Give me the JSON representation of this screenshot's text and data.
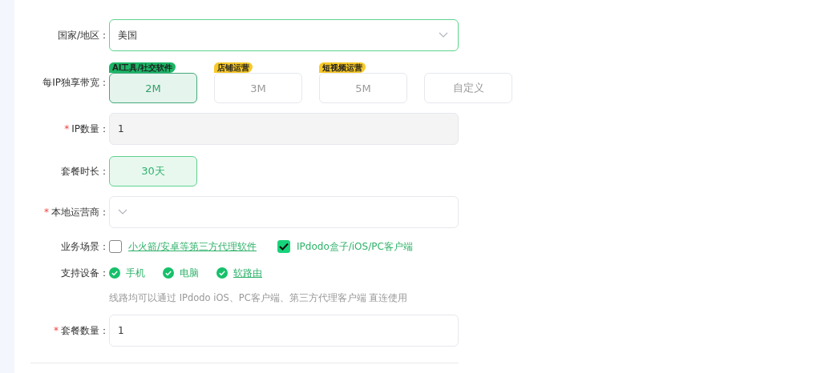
{
  "country": {
    "label": "国家/地区：",
    "value": "美国"
  },
  "bandwidth": {
    "label": "每IP独享带宽：",
    "options": [
      {
        "label": "2M",
        "tag": "AI工具/社交软件",
        "color": "#1bb466",
        "selected": true
      },
      {
        "label": "3M",
        "tag": "店铺运营",
        "color": "#f7c928",
        "selected": false
      },
      {
        "label": "5M",
        "tag": "短视频运营",
        "color": "#f7c928",
        "selected": false
      },
      {
        "label": "自定义",
        "selected": false
      }
    ]
  },
  "ip_count": {
    "label": "IP数量：",
    "required_mark": "*",
    "value": "1"
  },
  "duration": {
    "label": "套餐时长：",
    "options": [
      {
        "label": "30天",
        "selected": true
      }
    ]
  },
  "operator": {
    "label": "本地运营商：",
    "required_mark": "*"
  },
  "scenarios": {
    "label": "业务场景：",
    "options": [
      {
        "label": "小火箭/安卓等第三方代理软件",
        "checked": false
      },
      {
        "label": "IPdodo盒子/iOS/PC客户端",
        "checked": true
      }
    ]
  },
  "devices": {
    "label": "支持设备：",
    "items": [
      {
        "label": "手机",
        "link": false
      },
      {
        "label": "电脑",
        "link": false
      },
      {
        "label": "软路由",
        "link": true
      }
    ]
  },
  "note": "线路均可以通过 IPdodo iOS、PC客户端、第三方代理客户端 直连使用",
  "package_count": {
    "label": "套餐数量：",
    "required_mark": "*",
    "value": "1"
  }
}
